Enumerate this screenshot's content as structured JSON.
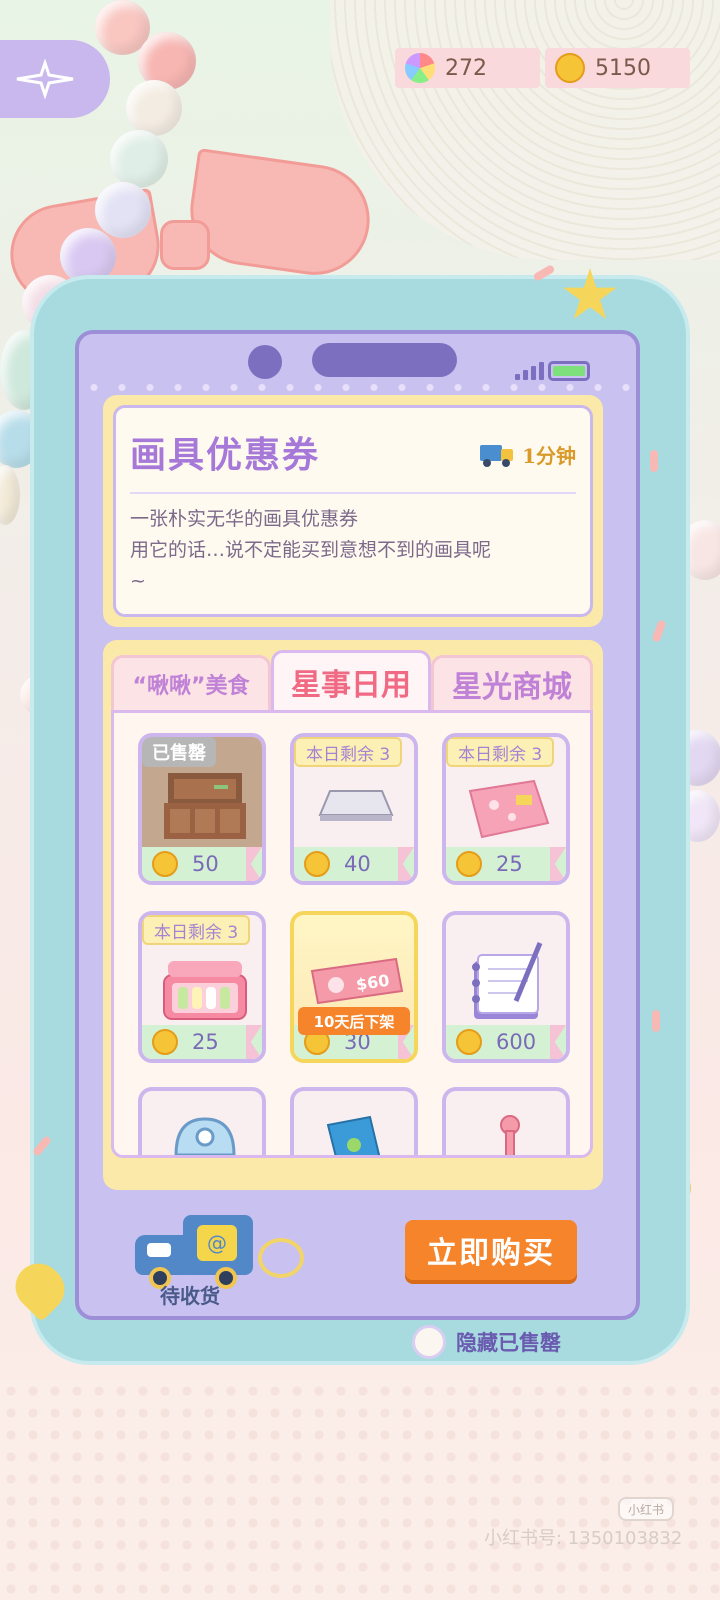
{
  "currencies": [
    {
      "icon": "rainbow-flower-icon",
      "value": "272"
    },
    {
      "icon": "gold-coin-icon",
      "value": "5150"
    }
  ],
  "item_detail": {
    "title": "画具优惠券",
    "delivery_time": "1分钟",
    "description_lines": [
      "一张朴实无华的画具优惠券",
      "用它的话…说不定能买到意想不到的画具呢",
      "~"
    ]
  },
  "tabs": [
    {
      "label": "“啾啾”美食",
      "active": false
    },
    {
      "label": "星事日用",
      "active": true
    },
    {
      "label": "星光商城",
      "active": false
    }
  ],
  "items": [
    {
      "name": "cabinet",
      "tag": "已售罄",
      "price": "50",
      "sold_out": true
    },
    {
      "name": "silver-bar",
      "tag": "本日剩余 3",
      "price": "40"
    },
    {
      "name": "pink-blanket",
      "tag": "本日剩余 3",
      "price": "25"
    },
    {
      "name": "paint-box",
      "tag": "本日剩余 3",
      "price": "25"
    },
    {
      "name": "ticket-coupon",
      "tag": "10天后下架",
      "price": "30",
      "ticket_text": "$60"
    },
    {
      "name": "notebook",
      "tag": "",
      "price": "600"
    },
    {
      "name": "helmet",
      "tag": "",
      "price": ""
    },
    {
      "name": "drink-card",
      "tag": "",
      "price": ""
    },
    {
      "name": "pink-stick",
      "tag": "",
      "price": ""
    }
  ],
  "bottom": {
    "pending_label": "待收货",
    "buy_button": "立即购买",
    "hide_sold_label": "隐藏已售罄"
  },
  "watermark": {
    "badge": "小红书",
    "id": "小红书号: 1350103832"
  },
  "colors": {
    "accent_purple": "#a678d8",
    "buy_orange": "#f6842b",
    "tab_active": "#f06a84"
  }
}
